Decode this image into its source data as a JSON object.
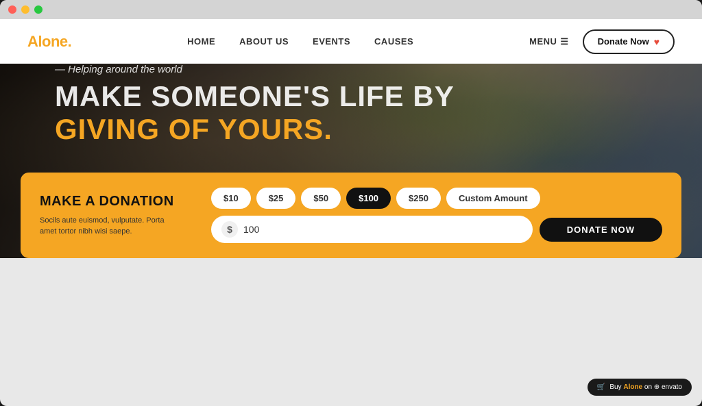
{
  "browser": {
    "buttons": {
      "close": "close",
      "minimize": "minimize",
      "maximize": "maximize"
    }
  },
  "navbar": {
    "logo": "Alone",
    "logo_dot": ".",
    "nav_links": [
      {
        "label": "HOME",
        "href": "#"
      },
      {
        "label": "ABOUT US",
        "href": "#"
      },
      {
        "label": "EVENTS",
        "href": "#"
      },
      {
        "label": "CAUSES",
        "href": "#"
      }
    ],
    "menu_label": "MENU",
    "donate_button_label": "Donate Now"
  },
  "hero": {
    "subtitle": "Helping around the world",
    "title_line1": "MAKE SOMEONE'S LIFE BY",
    "title_line2": "GIVING OF YOURS."
  },
  "donation": {
    "title": "MAKE A DONATION",
    "description": "Socils aute euismod, vulputate. Porta amet tortor nibh wisi saepe.",
    "amounts": [
      {
        "label": "$10",
        "value": "10",
        "active": false
      },
      {
        "label": "$25",
        "value": "25",
        "active": false
      },
      {
        "label": "$50",
        "value": "50",
        "active": false
      },
      {
        "label": "$100",
        "value": "100",
        "active": true
      },
      {
        "label": "$250",
        "value": "250",
        "active": false
      },
      {
        "label": "Custom Amount",
        "value": "custom",
        "active": false
      }
    ],
    "currency_symbol": "$",
    "input_value": "100",
    "donate_button_label": "DONATE NOW"
  },
  "envato": {
    "prefix": "Buy",
    "brand": "Alone",
    "suffix": "on  envato"
  }
}
